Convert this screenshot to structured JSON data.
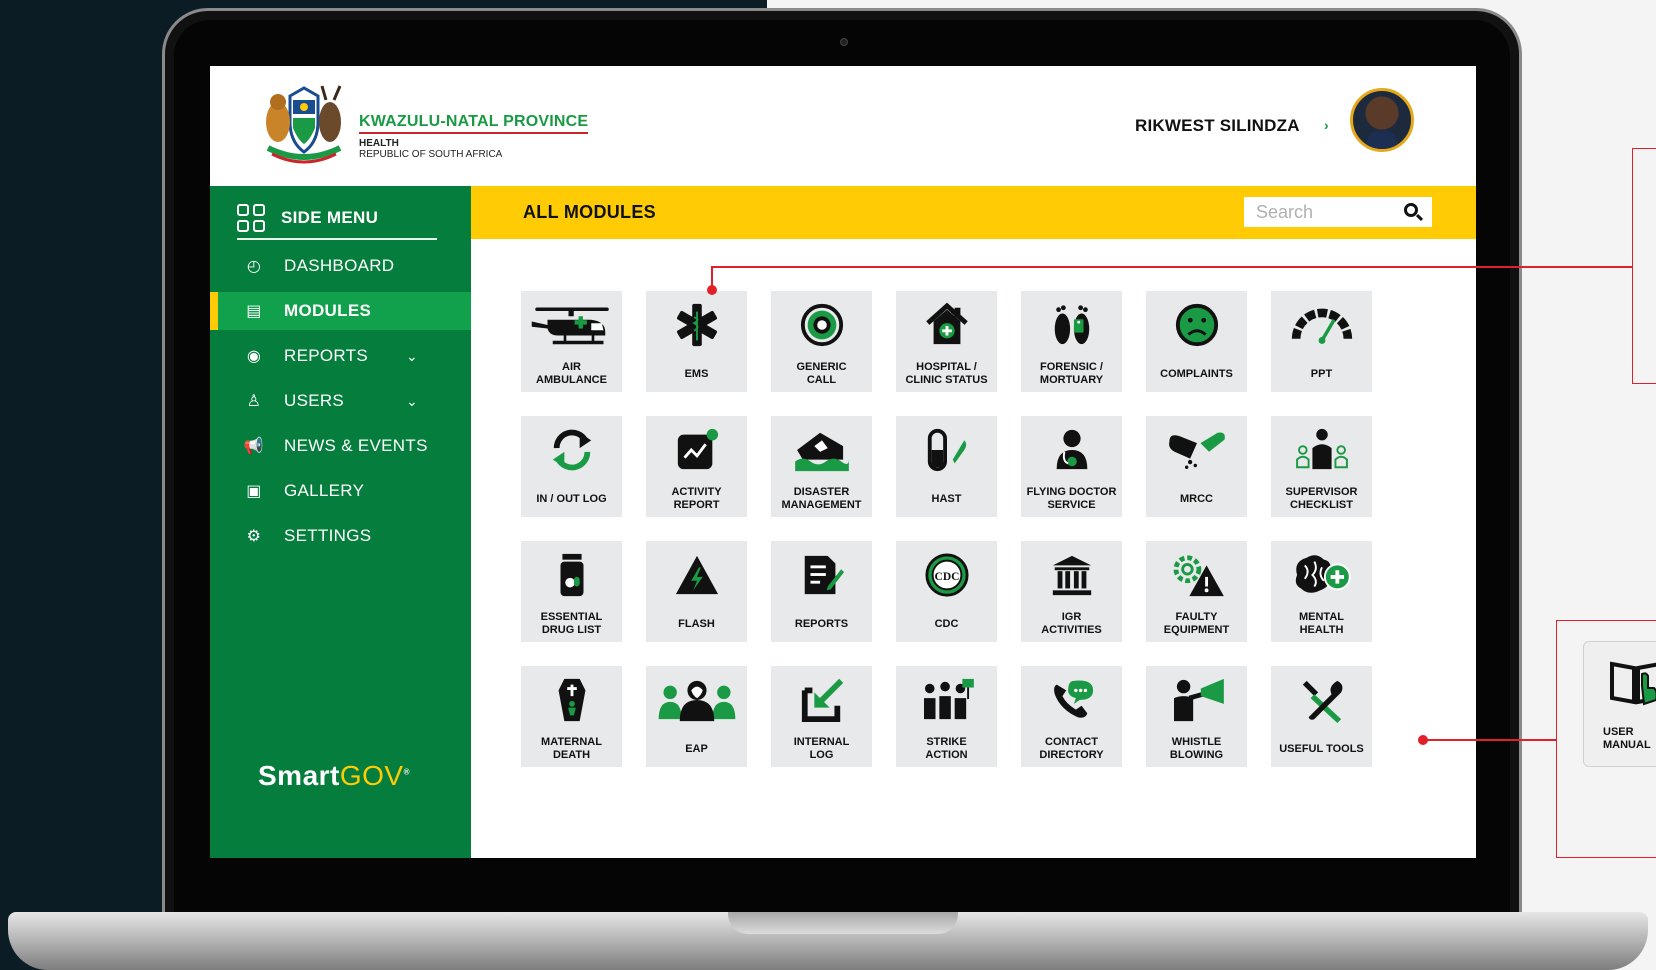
{
  "header": {
    "org_name": "KWAZULU-NATAL PROVINCE",
    "org_department": "HEALTH",
    "org_country": "REPUBLIC OF SOUTH AFRICA",
    "user_name": "RIKWEST SILINDZA",
    "user_chevron": "›"
  },
  "sidebar": {
    "title": "SIDE MENU",
    "items": [
      {
        "label": "DASHBOARD",
        "icon": "speedometer-icon",
        "glyph": "◴",
        "chevron": ""
      },
      {
        "label": "MODULES",
        "icon": "modules-icon",
        "glyph": "▤",
        "chevron": ""
      },
      {
        "label": "REPORTS",
        "icon": "reports-icon",
        "glyph": "◉",
        "chevron": "⌄"
      },
      {
        "label": "USERS",
        "icon": "users-icon",
        "glyph": "♙",
        "chevron": "⌄"
      },
      {
        "label": "NEWS & EVENTS",
        "icon": "megaphone-icon",
        "glyph": "📢",
        "chevron": ""
      },
      {
        "label": "GALLERY",
        "icon": "gallery-icon",
        "glyph": "▣",
        "chevron": ""
      },
      {
        "label": "SETTINGS",
        "icon": "settings-icon",
        "glyph": "⚙",
        "chevron": ""
      }
    ],
    "brand_smart": "Smart",
    "brand_gov": "GOV",
    "brand_mark": "®"
  },
  "main": {
    "title": "ALL MODULES",
    "search_placeholder": "Search"
  },
  "modules": [
    {
      "label": "AIR\nAMBULANCE",
      "icon": "helicopter-icon"
    },
    {
      "label": "EMS",
      "icon": "star-of-life-icon"
    },
    {
      "label": "GENERIC\nCALL",
      "icon": "generic-call-icon"
    },
    {
      "label": "HOSPITAL /\nCLINIC STATUS",
      "icon": "hospital-icon"
    },
    {
      "label": "FORENSIC /\nMORTUARY",
      "icon": "feet-tag-icon"
    },
    {
      "label": "COMPLAINTS",
      "icon": "sad-face-icon"
    },
    {
      "label": "PPT",
      "icon": "gauge-icon"
    },
    {
      "label": "IN / OUT LOG",
      "icon": "sync-arrows-icon"
    },
    {
      "label": "ACTIVITY\nREPORT",
      "icon": "activity-chart-icon"
    },
    {
      "label": "DISASTER\nMANAGEMENT",
      "icon": "flooded-house-icon"
    },
    {
      "label": "HAST",
      "icon": "pill-capsule-icon"
    },
    {
      "label": "FLYING DOCTOR\nSERVICE",
      "icon": "doctor-icon"
    },
    {
      "label": "MRCC",
      "icon": "capsules-icon"
    },
    {
      "label": "SUPERVISOR\nCHECKLIST",
      "icon": "supervisor-icon"
    },
    {
      "label": "ESSENTIAL\nDRUG LIST",
      "icon": "medicine-bottle-icon"
    },
    {
      "label": "FLASH",
      "icon": "flash-warning-icon"
    },
    {
      "label": "REPORTS",
      "icon": "document-edit-icon"
    },
    {
      "label": "CDC",
      "icon": "cdc-seal-icon"
    },
    {
      "label": "IGR\nACTIVITIES",
      "icon": "government-building-icon"
    },
    {
      "label": "FAULTY\nEQUIPMENT",
      "icon": "gear-warning-icon"
    },
    {
      "label": "MENTAL\nHEALTH",
      "icon": "brain-plus-icon"
    },
    {
      "label": "MATERNAL\nDEATH",
      "icon": "coffin-icon"
    },
    {
      "label": "EAP",
      "icon": "group-people-icon"
    },
    {
      "label": "INTERNAL\nLOG",
      "icon": "inbox-arrow-icon"
    },
    {
      "label": "STRIKE\nACTION",
      "icon": "protest-icon"
    },
    {
      "label": "CONTACT\nDIRECTORY",
      "icon": "phone-chat-icon"
    },
    {
      "label": "WHISTLE\nBLOWING",
      "icon": "whistleblower-icon"
    },
    {
      "label": "USEFUL TOOLS",
      "icon": "tools-icon"
    }
  ],
  "side_card": {
    "label": "USER\nMANUAL",
    "icon": "user-manual-icon"
  },
  "colors": {
    "green_dark": "#057d3c",
    "green_bright": "#11a14c",
    "yellow": "#ffcb05",
    "annotation_red": "#e0202a"
  }
}
